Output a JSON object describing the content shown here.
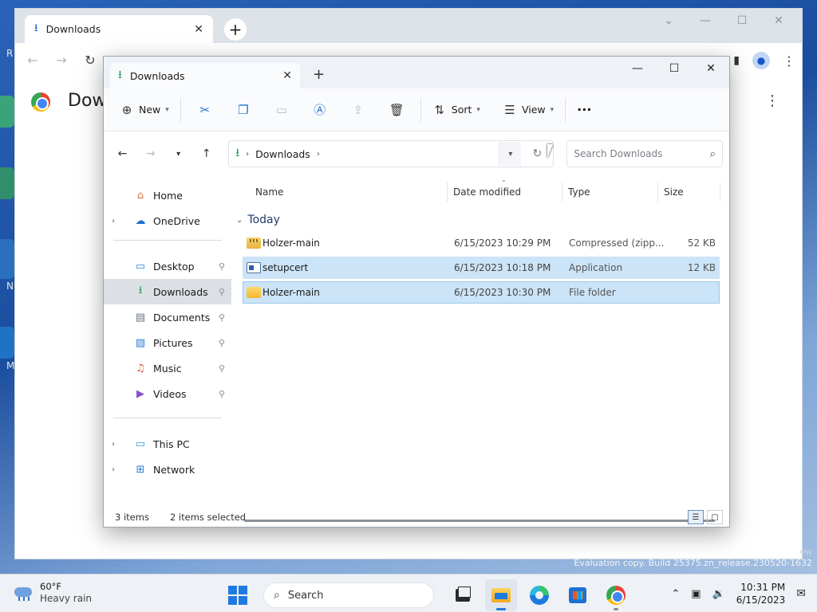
{
  "desktop": {
    "left_letters": [
      "R",
      "N",
      "M"
    ]
  },
  "chrome": {
    "tab_title": "Downloads",
    "page_heading": "Dow",
    "new_tab_symbol": "+",
    "colors": {
      "tabbar": "#dee3ea"
    }
  },
  "explorer": {
    "tab_title": "Downloads",
    "new_tab_symbol": "+",
    "commands": {
      "new_label": "New",
      "sort_label": "Sort",
      "view_label": "View",
      "more_label": "···"
    },
    "address": {
      "segment": "Downloads"
    },
    "search": {
      "placeholder": "Search Downloads"
    },
    "nav": {
      "home": "Home",
      "onedrive": "OneDrive",
      "desktop": "Desktop",
      "downloads": "Downloads",
      "documents": "Documents",
      "pictures": "Pictures",
      "music": "Music",
      "videos": "Videos",
      "this_pc": "This PC",
      "network": "Network"
    },
    "columns": {
      "name": "Name",
      "date": "Date modified",
      "type": "Type",
      "size": "Size"
    },
    "group_label": "Today",
    "files": [
      {
        "name": "Holzer-main",
        "date": "6/15/2023 10:29 PM",
        "type": "Compressed (zipp...",
        "size": "52 KB",
        "icon": "zip-folder-icon",
        "selected": false
      },
      {
        "name": "setupcert",
        "date": "6/15/2023 10:18 PM",
        "type": "Application",
        "size": "12 KB",
        "icon": "application-icon",
        "selected": true
      },
      {
        "name": "Holzer-main",
        "date": "6/15/2023 10:30 PM",
        "type": "File folder",
        "size": "",
        "icon": "folder-icon",
        "selected": true
      }
    ],
    "status": {
      "items": "3 items",
      "selected": "2 items selected"
    },
    "colors": {
      "selection": "#cce4f7",
      "accent": "#1e6fd1"
    }
  },
  "watermark": {
    "line1": "ew",
    "line2": "Evaluation copy. Build 25375.zn_release.230520-1632"
  },
  "taskbar": {
    "weather_temp": "60°F",
    "weather_desc": "Heavy rain",
    "search_label": "Search",
    "time": "10:31 PM",
    "date": "6/15/2023"
  }
}
